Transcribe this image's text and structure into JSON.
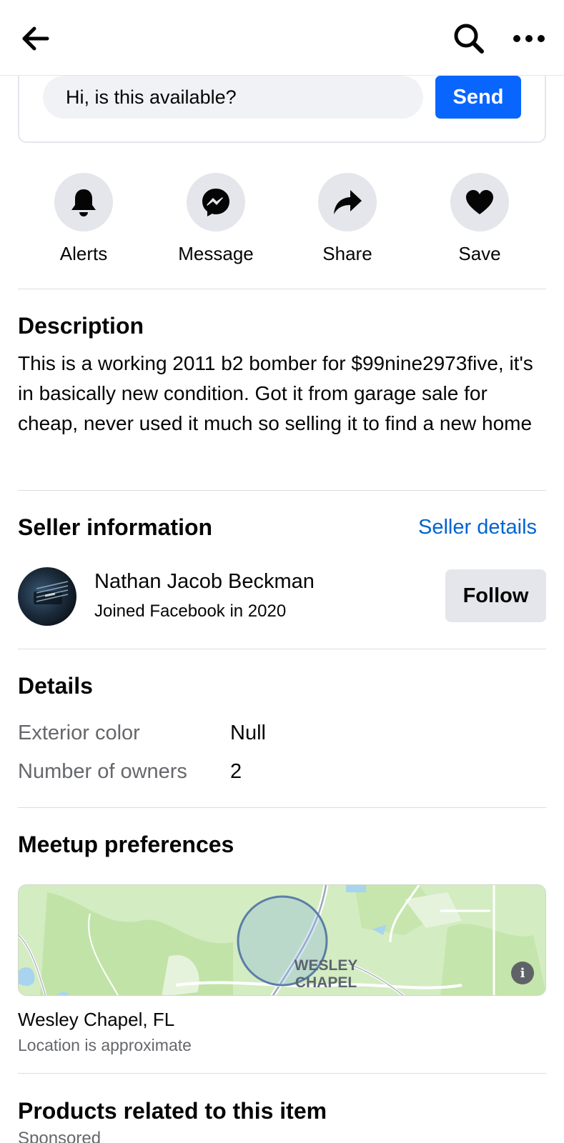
{
  "header": {
    "back_icon": "back-arrow-icon",
    "search_icon": "search-icon",
    "more_icon": "more-options-icon"
  },
  "message": {
    "input_value": "Hi, is this available?",
    "send_label": "Send"
  },
  "actions": [
    {
      "label": "Alerts",
      "icon": "bell-icon"
    },
    {
      "label": "Message",
      "icon": "messenger-icon"
    },
    {
      "label": "Share",
      "icon": "share-icon"
    },
    {
      "label": "Save",
      "icon": "heart-icon"
    }
  ],
  "description": {
    "heading": "Description",
    "text": "This is a working 2011 b2 bomber for $99nine2973five, it's in basically new condition. Got it from garage sale for cheap, never used it much so selling it to find a new home"
  },
  "seller": {
    "heading": "Seller information",
    "details_link": "Seller details",
    "name": "Nathan Jacob Beckman",
    "joined": "Joined Facebook in 2020",
    "follow_label": "Follow"
  },
  "details": {
    "heading": "Details",
    "rows": [
      {
        "label": "Exterior color",
        "value": "Null"
      },
      {
        "label": "Number of owners",
        "value": "2"
      }
    ]
  },
  "meetup": {
    "heading": "Meetup preferences",
    "map_label_line1": "WESLEY",
    "map_label_line2": "CHAPEL",
    "location": "Wesley Chapel, FL",
    "note": "Location is approximate",
    "info_icon": "info-icon"
  },
  "related": {
    "heading": "Products related to this item",
    "sponsored": "Sponsored"
  },
  "colors": {
    "accent": "#0866ff",
    "link": "#0064d1",
    "button_gray": "#e4e6eb",
    "secondary_text": "#65676b"
  }
}
